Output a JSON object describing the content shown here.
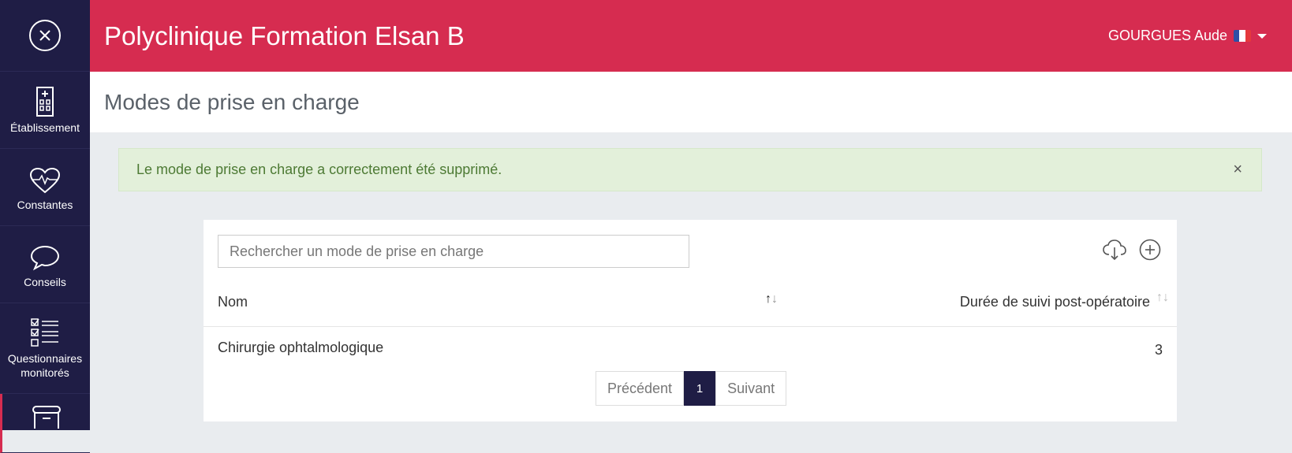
{
  "header": {
    "title": "Polyclinique Formation Elsan B",
    "user": "GOURGUES Aude"
  },
  "sidebar": {
    "items": [
      {
        "label": "Établissement"
      },
      {
        "label": "Constantes"
      },
      {
        "label": "Conseils"
      },
      {
        "label": "Questionnaires monitorés"
      }
    ]
  },
  "page": {
    "title": "Modes de prise en charge"
  },
  "alert": {
    "message": "Le mode de prise en charge a correctement été supprimé.",
    "close": "×"
  },
  "search": {
    "placeholder": "Rechercher un mode de prise en charge"
  },
  "table": {
    "columns": [
      "Nom",
      "Durée de suivi post-opératoire"
    ],
    "rows": [
      {
        "nom": "Chirurgie ophtalmologique",
        "duree": "3"
      }
    ]
  },
  "pagination": {
    "prev": "Précédent",
    "current": "1",
    "next": "Suivant"
  },
  "colors": {
    "primary": "#d62c50",
    "sidebar": "#1f1d45",
    "alert_bg": "#e3f0da"
  }
}
